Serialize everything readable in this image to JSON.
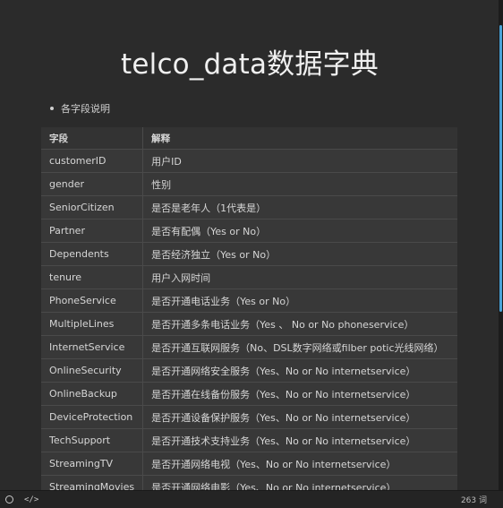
{
  "doc": {
    "title": "telco_data数据字典",
    "bullet": "各字段说明"
  },
  "table": {
    "headers": [
      "字段",
      "解释"
    ],
    "rows": [
      [
        "customerID",
        "用户ID"
      ],
      [
        "gender",
        "性别"
      ],
      [
        "SeniorCitizen",
        "是否是老年人（1代表是）"
      ],
      [
        "Partner",
        "是否有配偶（Yes or No）"
      ],
      [
        "Dependents",
        "是否经济独立（Yes or No）"
      ],
      [
        "tenure",
        "用户入网时间"
      ],
      [
        "PhoneService",
        "是否开通电话业务（Yes or No）"
      ],
      [
        "MultipleLines",
        "是否开通多条电话业务（Yes 、 No or No phoneservice）"
      ],
      [
        "InternetService",
        "是否开通互联网服务（No、DSL数字网络或filber potic光线网络）"
      ],
      [
        "OnlineSecurity",
        "是否开通网络安全服务（Yes、No or No internetservice）"
      ],
      [
        "OnlineBackup",
        "是否开通在线备份服务（Yes、No or No internetservice）"
      ],
      [
        "DeviceProtection",
        "是否开通设备保护服务（Yes、No or No internetservice）"
      ],
      [
        "TechSupport",
        "是否开通技术支持业务（Yes、No or No internetservice）"
      ],
      [
        "StreamingTV",
        "是否开通网络电视（Yes、No or No internetservice）"
      ],
      [
        "StreamingMovies",
        "是否开通网络电影（Yes、No or No internetservice）"
      ]
    ]
  },
  "status": {
    "circle_icon": "circle-icon",
    "code_icon": "code-icon",
    "code_glyph": "</>",
    "word_count": "263 词"
  },
  "colors": {
    "background": "#2b2b2b",
    "scrollbar_thumb": "#4aa3d8"
  }
}
